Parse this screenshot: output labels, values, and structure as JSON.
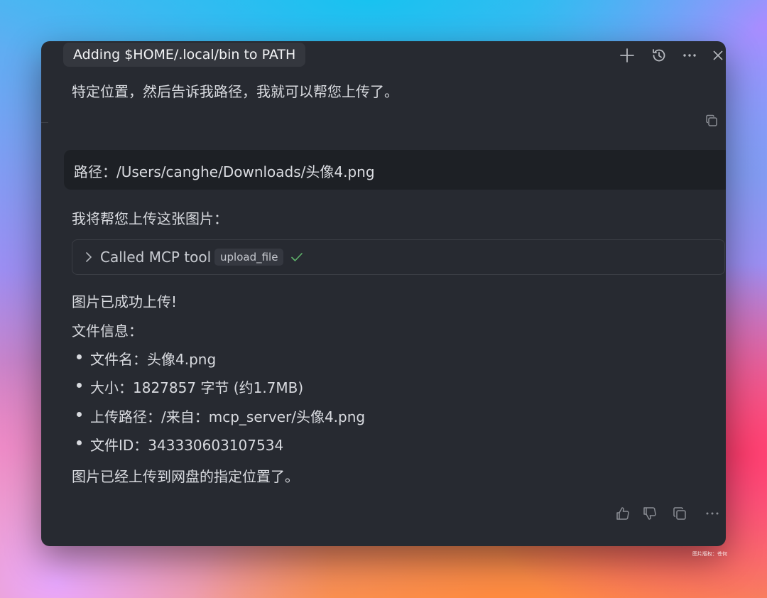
{
  "header": {
    "tab_title": "Adding $HOME/.local/bin to PATH",
    "icons": [
      "plus-icon",
      "history-icon",
      "more-icon",
      "close-icon"
    ]
  },
  "conversation": {
    "previous_tail": "特定位置，然后告诉我路径，我就可以帮您上传了。",
    "user_message": "路径：/Users/canghe/Downloads/头像4.png",
    "assistant_intro": "我将帮您上传这张图片：",
    "tool_call": {
      "label": "Called MCP tool",
      "tool_name": "upload_file",
      "status": "success"
    },
    "result_heading": "图片已成功上传!",
    "info_heading": "文件信息：",
    "info_items": [
      "文件名：头像4.png",
      "大小：1827857 字节 (约1.7MB)",
      "上传路径：/来自：mcp_server/头像4.png",
      "文件ID：343330603107534"
    ],
    "closing": "图片已经上传到网盘的指定位置了。"
  },
  "actions": [
    "thumbs-up-icon",
    "thumbs-down-icon",
    "copy-icon",
    "more-icon"
  ],
  "watermark": "图片版权：苍何",
  "colors": {
    "panel_bg": "#272a31",
    "user_bubble_bg": "#1d2025",
    "text": "#d9dbe0",
    "success_check": "#5fb36b"
  }
}
